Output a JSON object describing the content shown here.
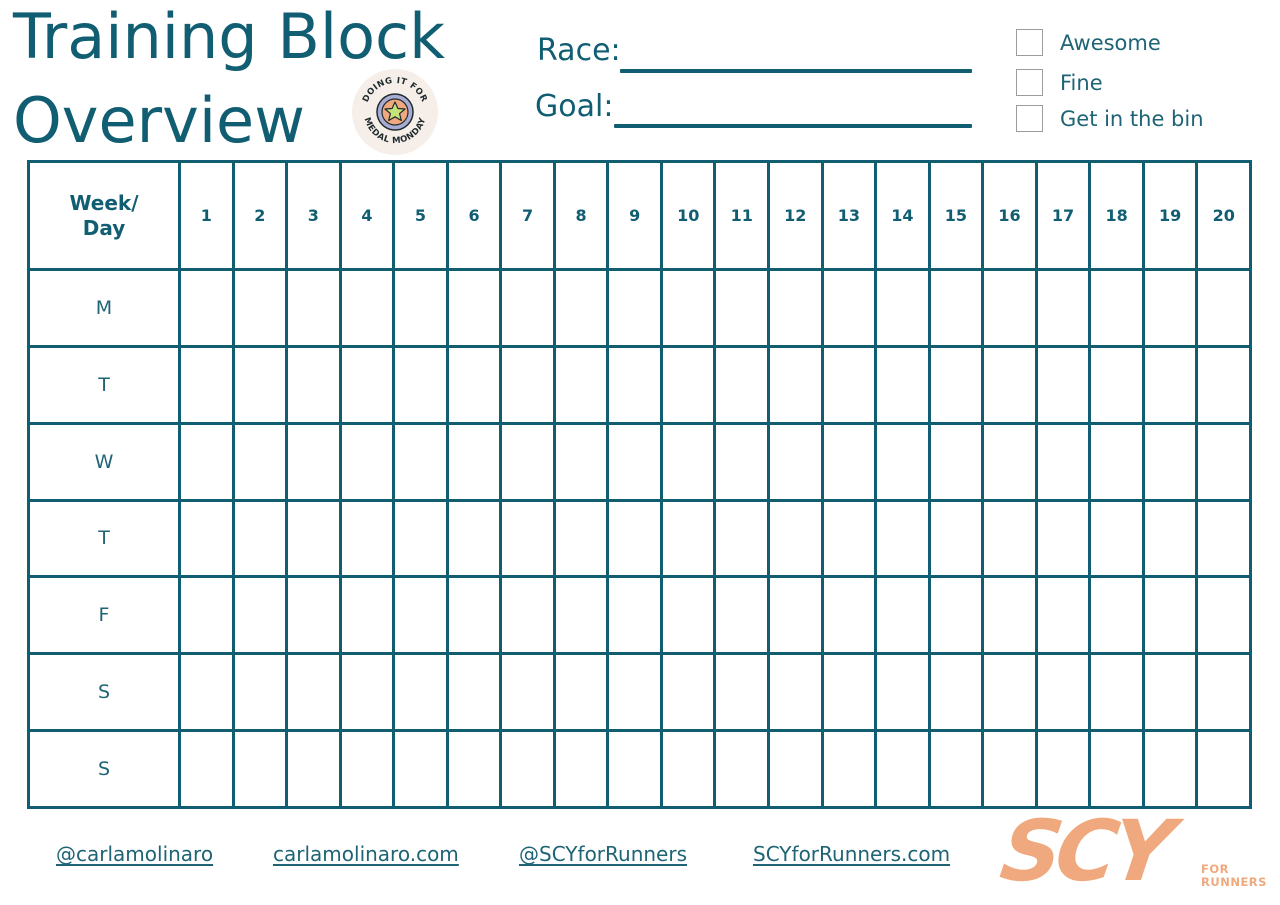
{
  "header": {
    "title_line1": "Training Block",
    "title_line2": "Overview",
    "badge": {
      "icon": "medal-star-icon",
      "top_text": "DOING IT FOR",
      "bottom_text": "MEDAL MONDAY"
    }
  },
  "fields": {
    "race_label": "Race:",
    "race_value": "",
    "goal_label": "Goal:",
    "goal_value": ""
  },
  "ratings": [
    {
      "label": "Awesome",
      "checked": false
    },
    {
      "label": "Fine",
      "checked": false
    },
    {
      "label": "Get in the bin",
      "checked": false
    }
  ],
  "grid": {
    "corner_label_line1": "Week/",
    "corner_label_line2": "Day",
    "weeks": [
      "1",
      "2",
      "3",
      "4",
      "5",
      "6",
      "7",
      "8",
      "9",
      "10",
      "11",
      "12",
      "13",
      "14",
      "15",
      "16",
      "17",
      "18",
      "19",
      "20"
    ],
    "days": [
      "M",
      "T",
      "W",
      "T",
      "F",
      "S",
      "S"
    ]
  },
  "footer": {
    "links": [
      "@carlamolinaro",
      "carlamolinaro.com",
      "@SCYforRunners",
      "SCYforRunners.com"
    ],
    "logo": {
      "main": "SCY",
      "sub_line1": "FOR",
      "sub_line2": "RUNNERS"
    }
  },
  "colors": {
    "primary": "#115e73",
    "accent": "#f0a97e"
  }
}
